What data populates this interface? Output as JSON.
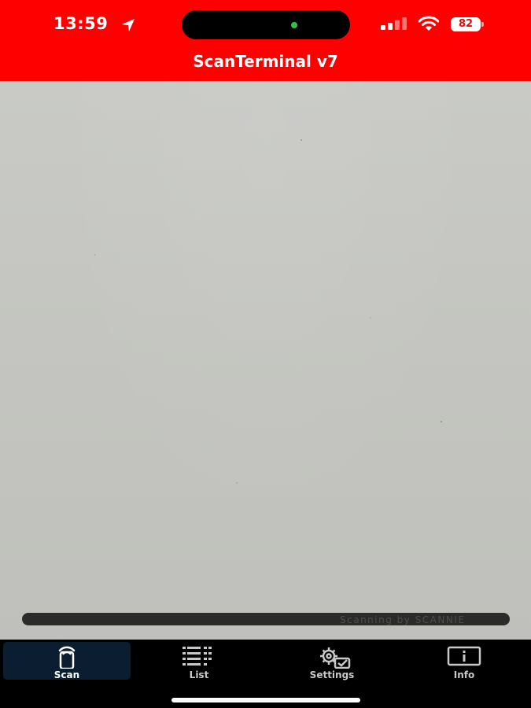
{
  "status_bar": {
    "time": "13:59",
    "battery": "82",
    "icons": [
      "location-arrow-icon",
      "signal-bars-icon",
      "wifi-icon",
      "battery-icon"
    ]
  },
  "header": {
    "title": "ScanTerminal v7",
    "background": "#ff0000"
  },
  "scanner": {
    "watermark": "Scanning by SCANNIE"
  },
  "tab_bar": {
    "tabs": [
      {
        "label": "Scan",
        "icon": "phone-scan-icon",
        "active": true
      },
      {
        "label": "List",
        "icon": "list-icon",
        "active": false
      },
      {
        "label": "Settings",
        "icon": "gear-settings-icon",
        "active": false
      },
      {
        "label": "Info",
        "icon": "info-icon",
        "active": false
      }
    ],
    "active_color": "#0b1d30"
  }
}
